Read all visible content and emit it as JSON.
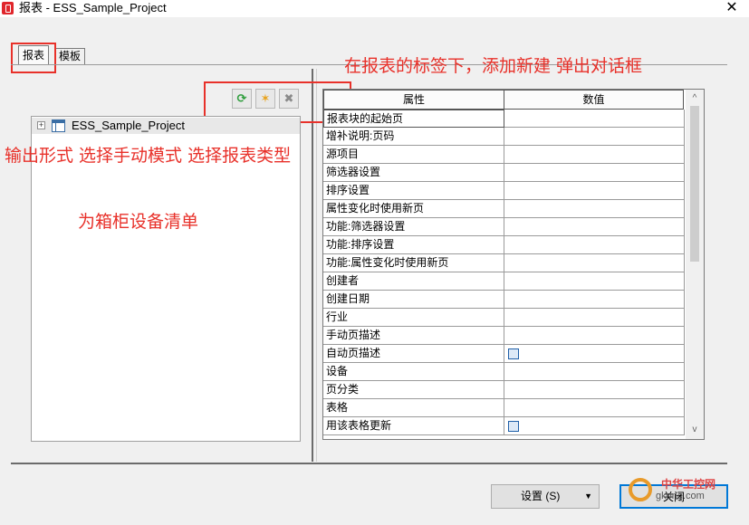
{
  "window": {
    "title": "报表 - ESS_Sample_Project",
    "close_glyph": "✕"
  },
  "tabs": [
    {
      "label": "报表",
      "selected": true
    },
    {
      "label": "模板",
      "selected": false
    }
  ],
  "toolbar": {
    "refresh_glyph": "⟳",
    "new_glyph": "✶",
    "delete_glyph": "✖"
  },
  "tree": {
    "expand_glyph": "+",
    "root_label": "ESS_Sample_Project"
  },
  "property_grid": {
    "headers": [
      "属性",
      "数值"
    ],
    "rows": [
      {
        "name": "报表块的起始页",
        "checkbox": false
      },
      {
        "name": "增补说明:页码",
        "checkbox": false
      },
      {
        "name": "源项目",
        "checkbox": false
      },
      {
        "name": "筛选器设置",
        "checkbox": false
      },
      {
        "name": "排序设置",
        "checkbox": false
      },
      {
        "name": "属性变化时使用新页",
        "checkbox": false
      },
      {
        "name": "功能:筛选器设置",
        "checkbox": false
      },
      {
        "name": "功能:排序设置",
        "checkbox": false
      },
      {
        "name": "功能:属性变化时使用新页",
        "checkbox": false
      },
      {
        "name": "创建者",
        "checkbox": false
      },
      {
        "name": "创建日期",
        "checkbox": false
      },
      {
        "name": "行业",
        "checkbox": false
      },
      {
        "name": "手动页描述",
        "checkbox": false
      },
      {
        "name": "自动页描述",
        "checkbox": true
      },
      {
        "name": "设备",
        "checkbox": false
      },
      {
        "name": "页分类",
        "checkbox": false
      },
      {
        "name": "表格",
        "checkbox": false
      },
      {
        "name": "用该表格更新",
        "checkbox": true
      }
    ],
    "scroll_up_glyph": "^",
    "scroll_down_glyph": "v"
  },
  "buttons": {
    "settings_label": "设置 (S)",
    "settings_caret": "▼",
    "close_label": "关闭"
  },
  "annotations": {
    "note_dialog": "在报表的标签下，添加新建 弹出对话框",
    "note_output": "输出形式 选择手动模式 选择报表类型",
    "note_cabinet": "为箱柜设备清单"
  },
  "watermark": {
    "brand": "中华工控网",
    "site": "gkong.com"
  },
  "colors": {
    "annotation_red": "#e8312a",
    "checkbox_blue": "#1f5fa8",
    "focus_blue": "#0078d7"
  }
}
